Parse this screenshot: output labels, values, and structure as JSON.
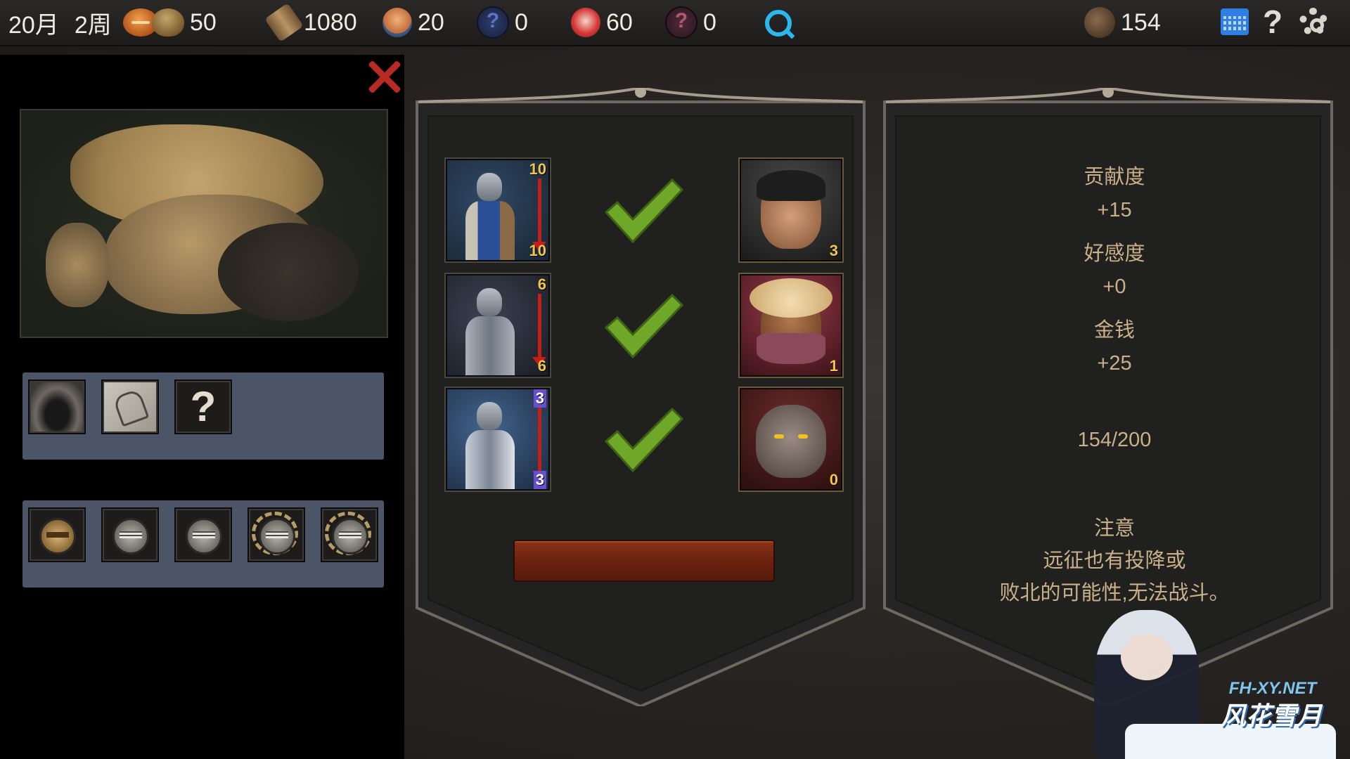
{
  "topbar": {
    "month": "20月",
    "week": "2周",
    "resources": [
      {
        "icon": "bread-icon",
        "value": ""
      },
      {
        "icon": "gold-sack-icon",
        "value": "50"
      },
      {
        "icon": "wood-log-icon",
        "value": "1080"
      },
      {
        "icon": "hero-portrait-icon",
        "value": "20"
      },
      {
        "icon": "mystery-blue-icon",
        "value": "0"
      },
      {
        "icon": "girl-portrait-icon",
        "value": "60"
      },
      {
        "icon": "mystery-red-icon",
        "value": "0"
      },
      {
        "icon": "stone-icon",
        "value": "154"
      }
    ],
    "help_symbol": "?"
  },
  "left": {
    "slot_help_symbol": "?"
  },
  "units": [
    {
      "top": "10",
      "bottom": "10",
      "type": "spearman"
    },
    {
      "top": "6",
      "bottom": "6",
      "type": "armored-infantry"
    },
    {
      "top": "3",
      "bottom": "3",
      "type": "cavalry"
    }
  ],
  "enemies": [
    {
      "level": "3",
      "type": "bandit"
    },
    {
      "level": "1",
      "type": "turbaned-rogue"
    },
    {
      "level": "0",
      "type": "brute"
    }
  ],
  "rewards": {
    "contribution_label": "贡献度",
    "contribution_value": "+15",
    "favor_label": "好感度",
    "favor_value": "+0",
    "money_label": "金钱",
    "money_value": "+25",
    "capacity": "154/200"
  },
  "notice": {
    "title": "注意",
    "line1": "远征也有投降或",
    "line2": "败北的可能性,无法战斗。"
  },
  "watermark": {
    "site": "FH-XY.NET",
    "name": "风花雪月"
  },
  "colors": {
    "accent_red": "#c41f17",
    "check_green": "#6fa829",
    "gold_text": "#c9b089",
    "level_yellow": "#f1c44a"
  }
}
